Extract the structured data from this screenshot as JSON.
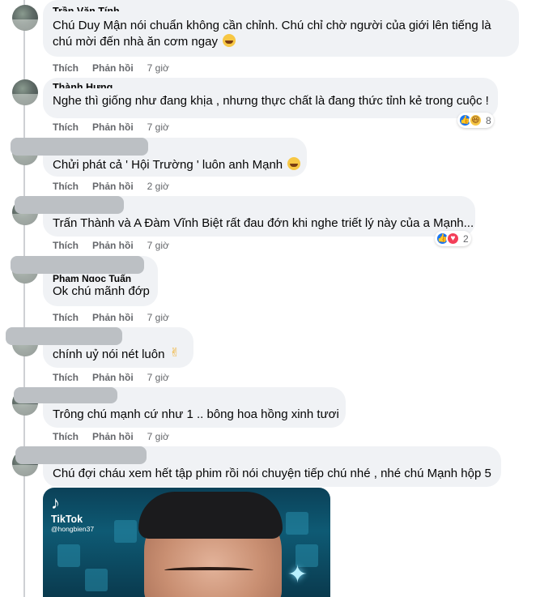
{
  "comments": [
    {
      "author": "Trần Văn Tính",
      "text": "Chú Duy Mận nói chuẩn không cần chỉnh. Chú chỉ chờ người của giới lên tiếng là chú mời đến nhà ăn cơm ngay",
      "emoji": "grinning-emoji",
      "like": "Thích",
      "reply": "Phản hồi",
      "time": "7 giờ"
    },
    {
      "author": "Thành Hưng",
      "text": "Nghe thì giống như đang khịa , nhưng thực chất là đang thức tỉnh kẻ trong cuộc !",
      "like": "Thích",
      "reply": "Phản hồi",
      "time": "7 giờ",
      "reactions": {
        "types": [
          "like",
          "haha"
        ],
        "count": "8"
      }
    },
    {
      "author": "",
      "text": "Chửi phát cả ' Hội Trường ' luôn anh Mạnh",
      "emoji": "grinning-emoji",
      "like": "Thích",
      "reply": "Phản hồi",
      "time": "2 giờ"
    },
    {
      "author": "",
      "text": "Trấn Thành và A Đàm Vĩnh Biệt rất đau đớn khi nghe triết lý này của a Mạnh...",
      "like": "Thích",
      "reply": "Phản hồi",
      "time": "7 giờ",
      "reactions": {
        "types": [
          "like",
          "love"
        ],
        "count": "2"
      }
    },
    {
      "author": "Phạm Ngọc Tuấn",
      "text": "Ok chú mãnh đớp",
      "like": "Thích",
      "reply": "Phản hồi",
      "time": "7 giờ"
    },
    {
      "author": "",
      "text": "chính uỷ nói nét luôn",
      "emoji": "victory-hand-emoji",
      "like": "Thích",
      "reply": "Phản hồi",
      "time": "7 giờ"
    },
    {
      "author": "",
      "text": "Trông chú mạnh cứ như 1 .. bông hoa hồng xinh tươi",
      "like": "Thích",
      "reply": "Phản hồi",
      "time": "7 giờ"
    },
    {
      "author": "",
      "text": "Chú đợi cháu xem hết tập phim rồi nói chuyện tiếp chú nhé , nhé chú Mạnh hộp 5"
    }
  ],
  "video": {
    "brand": "TikTok",
    "handle": "@hongbien37"
  }
}
